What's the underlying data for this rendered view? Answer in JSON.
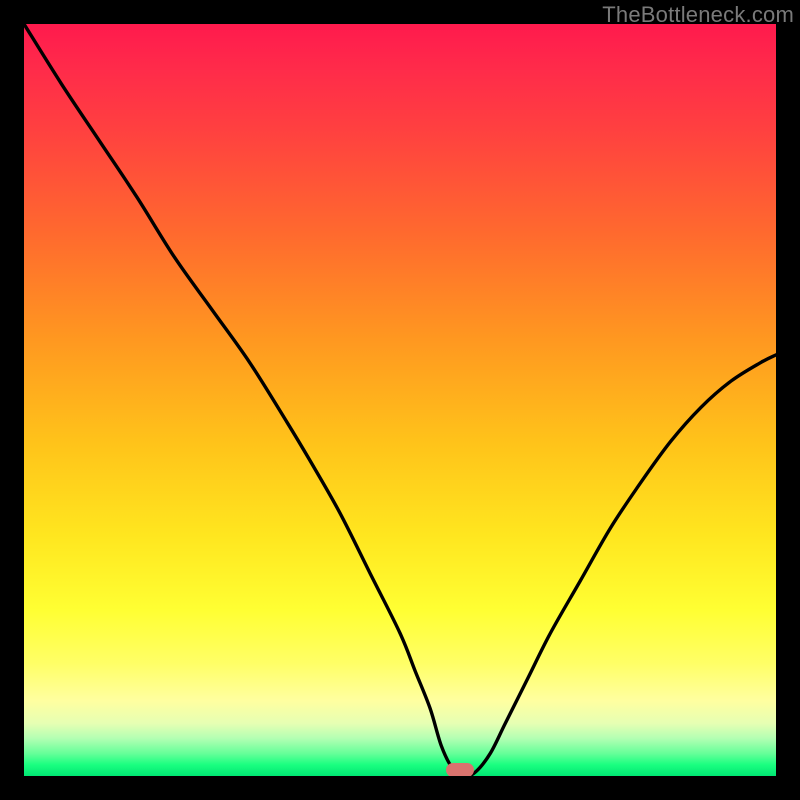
{
  "watermark": "TheBottleneck.com",
  "colors": {
    "frame": "#000000",
    "curve": "#000000",
    "marker": "#d9736e"
  },
  "chart_data": {
    "type": "line",
    "title": "",
    "xlabel": "",
    "ylabel": "",
    "xlim": [
      0,
      100
    ],
    "ylim": [
      0,
      100
    ],
    "grid": false,
    "series": [
      {
        "name": "bottleneck-curve",
        "x": [
          0,
          5,
          10,
          15,
          20,
          25,
          30,
          35,
          38,
          42,
          46,
          50,
          52,
          54,
          55.5,
          57,
          58.5,
          60,
          62,
          64,
          67,
          70,
          74,
          78,
          82,
          86,
          90,
          94,
          98,
          100
        ],
        "y": [
          100,
          92,
          84.5,
          77,
          69,
          62,
          55,
          47,
          42,
          35,
          27,
          19,
          14,
          9,
          4,
          1,
          0,
          0.5,
          3,
          7,
          13,
          19,
          26,
          33,
          39,
          44.5,
          49,
          52.5,
          55,
          56
        ]
      }
    ],
    "minimum_marker": {
      "x": 58,
      "y": 0
    },
    "gradient_stops": [
      {
        "pos": 0.0,
        "color": "#ff1a4d"
      },
      {
        "pos": 0.06,
        "color": "#ff2b4a"
      },
      {
        "pos": 0.14,
        "color": "#ff4040"
      },
      {
        "pos": 0.28,
        "color": "#ff6a2e"
      },
      {
        "pos": 0.42,
        "color": "#ff9820"
      },
      {
        "pos": 0.56,
        "color": "#ffc41a"
      },
      {
        "pos": 0.68,
        "color": "#ffe61f"
      },
      {
        "pos": 0.78,
        "color": "#ffff33"
      },
      {
        "pos": 0.85,
        "color": "#ffff66"
      },
      {
        "pos": 0.9,
        "color": "#ffffa0"
      },
      {
        "pos": 0.93,
        "color": "#e6ffb3"
      },
      {
        "pos": 0.95,
        "color": "#b3ffb3"
      },
      {
        "pos": 0.97,
        "color": "#66ff99"
      },
      {
        "pos": 0.985,
        "color": "#1aff80"
      },
      {
        "pos": 1.0,
        "color": "#00e673"
      }
    ]
  }
}
